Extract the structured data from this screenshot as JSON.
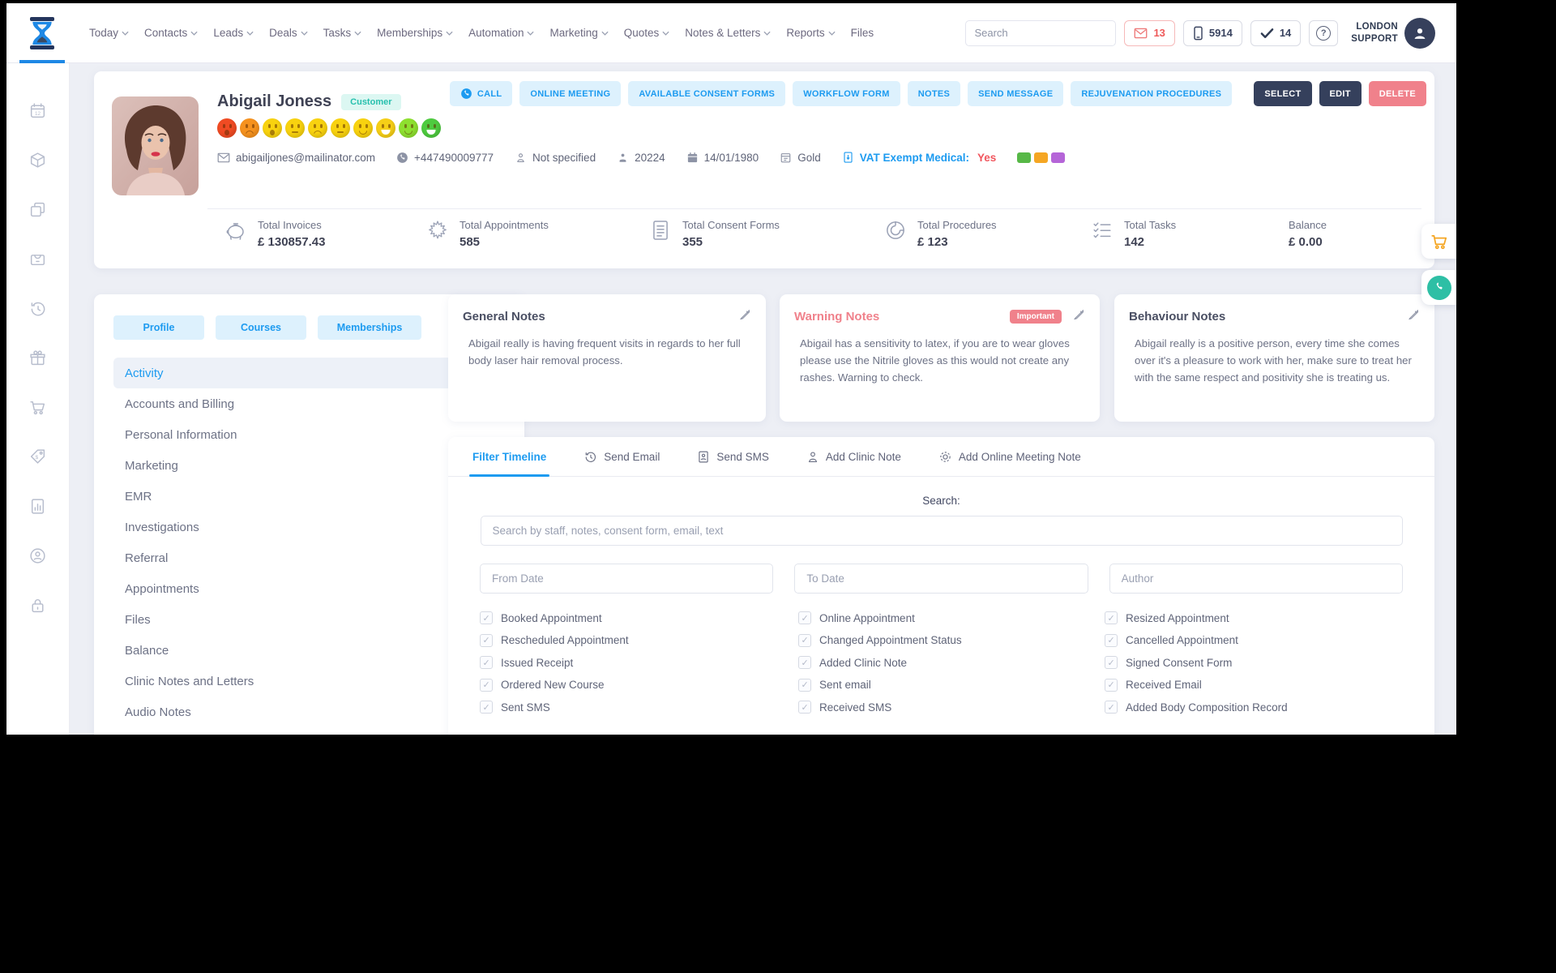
{
  "topbar": {
    "nav": [
      "Today",
      "Contacts",
      "Leads",
      "Deals",
      "Tasks",
      "Memberships",
      "Automation",
      "Marketing",
      "Quotes",
      "Notes & Letters",
      "Reports",
      "Files"
    ],
    "search_placeholder": "Search",
    "mail_count": "13",
    "call_count": "5914",
    "task_count": "14",
    "help": "?",
    "user_line1": "LONDON",
    "user_line2": "SUPPORT"
  },
  "rail": {
    "icons": [
      "calendar",
      "products",
      "duplicate",
      "pos-drawer",
      "history",
      "gift",
      "cart",
      "pricing",
      "reports",
      "client-support",
      "lock"
    ]
  },
  "client": {
    "name": "Abigail Joness",
    "badge": "Customer",
    "email": "abigailjones@mailinator.com",
    "phone": "+447490009777",
    "gender": "Not specified",
    "id": "20224",
    "dob": "14/01/1980",
    "tier": "Gold",
    "vat_label": "VAT Exempt Medical:",
    "vat_value": "Yes",
    "tags": [
      {
        "name": "green-label",
        "style": "background:#57b847"
      },
      {
        "name": "orange-label",
        "style": "background:#f5a623"
      },
      {
        "name": "purple-label",
        "style": "background:#b565d8"
      }
    ],
    "mood_faces": [
      {
        "style": "background:#f04b23",
        "mouth": "mouth m-open-sad"
      },
      {
        "style": "background:#f6921e",
        "mouth": "mouth m-sad"
      },
      {
        "style": "background:#f8d20f",
        "mouth": "mouth m-open-sad"
      },
      {
        "style": "background:#f8d20f",
        "mouth": "mouth m-flat"
      },
      {
        "style": "background:#f8d20f",
        "mouth": "mouth m-sad"
      },
      {
        "style": "background:#f8d20f",
        "mouth": "mouth m-flat"
      },
      {
        "style": "background:#f8d20f",
        "mouth": "mouth m-smile"
      },
      {
        "style": "background:#f6cf17",
        "mouth": "mouth m-grin"
      },
      {
        "style": "background:#8ee02f",
        "mouth": "mouth m-smile"
      },
      {
        "style": "background:#4ecb3f",
        "mouth": "mouth m-grin"
      }
    ],
    "actions": [
      "CALL",
      "ONLINE MEETING",
      "AVAILABLE CONSENT FORMS",
      "WORKFLOW FORM",
      "NOTES",
      "SEND MESSAGE",
      "REJUVENATION PROCEDURES"
    ],
    "action_select": "SELECT",
    "action_edit": "EDIT",
    "action_delete": "DELETE",
    "stats": [
      {
        "icon": "piggy-bank",
        "label": "Total Invoices",
        "value": "£ 130857.43"
      },
      {
        "icon": "sparkle",
        "label": "Total Appointments",
        "value": "585"
      },
      {
        "icon": "document",
        "label": "Total Consent Forms",
        "value": "355"
      },
      {
        "icon": "donut-chart",
        "label": "Total Procedures",
        "value": "£ 123"
      },
      {
        "icon": "checklist",
        "label": "Total Tasks",
        "value": "142"
      },
      {
        "icon": "none",
        "label": "Balance",
        "value": "£ 0.00"
      }
    ]
  },
  "side_panel": {
    "tabs": [
      "Profile",
      "Courses",
      "Memberships"
    ],
    "menu": [
      "Activity",
      "Accounts and Billing",
      "Personal Information",
      "Marketing",
      "EMR",
      "Investigations",
      "Referral",
      "Appointments",
      "Files",
      "Balance",
      "Clinic Notes and Letters",
      "Audio Notes"
    ],
    "active": "Activity"
  },
  "notes": {
    "general": {
      "title": "General Notes",
      "body": "Abigail really is having frequent visits in regards to her full body laser hair removal process."
    },
    "warning": {
      "title": "Warning Notes",
      "badge": "Important",
      "body": "Abigail has a sensitivity to latex, if you are to wear gloves please use the Nitrile gloves as this would not create any rashes. Warning to check."
    },
    "behaviour": {
      "title": "Behaviour Notes",
      "body": "Abigail really is a positive person, every time she comes over it's a pleasure to work with her, make sure to treat her with the same respect and positivity she is treating us."
    }
  },
  "timeline": {
    "tabs": [
      "Filter Timeline",
      "Send Email",
      "Send SMS",
      "Add Clinic Note",
      "Add Online Meeting Note"
    ],
    "search_label": "Search:",
    "search_placeholder": "Search by staff, notes, consent form, email, text",
    "from_placeholder": "From Date",
    "to_placeholder": "To Date",
    "author_placeholder": "Author",
    "checkboxes": [
      "Booked Appointment",
      "Online Appointment",
      "Resized Appointment",
      "Rescheduled Appointment",
      "Changed Appointment Status",
      "Cancelled Appointment",
      "Issued Receipt",
      "Added Clinic Note",
      "Signed Consent Form",
      "Ordered New Course",
      "Sent email",
      "Received Email",
      "Sent SMS",
      "Received SMS",
      "Added Body Composition Record"
    ],
    "checkboxes_checked": true
  },
  "floating": {
    "icons": [
      "cart",
      "whatsapp-call"
    ]
  },
  "colors": {
    "accent_blue": "#1d9bf0",
    "navy": "#35405c",
    "danger": "#f0818b",
    "teal_badge": "#27c0ae",
    "orange": "#f5a623",
    "light_blue_btn": "#ddf1fd"
  }
}
